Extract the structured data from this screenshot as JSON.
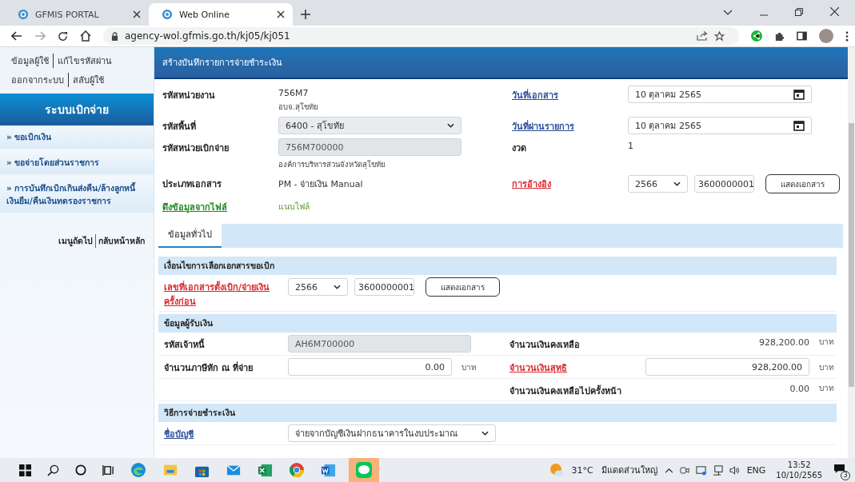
{
  "browser": {
    "tabs": [
      {
        "title": "GFMIS PORTAL",
        "selected": false
      },
      {
        "title": "Web Online",
        "selected": true
      }
    ],
    "url": "agency-wol.gfmis.go.th/kj05/kj051"
  },
  "sidebar": {
    "links": [
      [
        "ข้อมูลผู้ใช้",
        "แก้ไขรหัสผ่าน"
      ],
      [
        "ออกจากระบบ",
        "สลับผู้ใช้"
      ]
    ],
    "title": "ระบบเบิกจ่าย",
    "items": [
      "» ขอเบิกเงิน",
      "» ขอจ่ายโดยส่วนราชการ",
      "» การบันทึกเบิกเกินส่งคืน/ล้างลูกหนี้เงินยืม/คืนเงินทดรองราชการ"
    ],
    "footer_links": [
      "เมนูถัดไป",
      "กลับหน้าหลัก"
    ]
  },
  "page": {
    "subtitle": "สร้างบันทึกรายการจ่ายชำระเงิน"
  },
  "header_rows": [
    {
      "left": {
        "label": "รหัสหน่วยงาน",
        "link": false,
        "required": false,
        "kind": "text",
        "value": "756M7",
        "note": "อบจ.สุโขทัย"
      },
      "right": {
        "label": "วันที่เอกสาร",
        "link": true,
        "required": false,
        "kind": "date",
        "value": "10 ตุลาคม 2565"
      }
    },
    {
      "left": {
        "label": "รหัสพื้นที่",
        "link": false,
        "required": false,
        "kind": "select",
        "value": "6400 - สุโขทัย"
      },
      "right": {
        "label": "วันที่ผ่านรายการ",
        "link": true,
        "required": false,
        "kind": "date",
        "value": "10 ตุลาคม 2565"
      }
    },
    {
      "left": {
        "label": "รหัสหน่วยเบิกจ่าย",
        "link": false,
        "required": false,
        "kind": "disabled",
        "value": "756M700000",
        "note": "องค์การบริหารส่วนจังหวัดสุโขทัย"
      },
      "right": {
        "label": "งวด",
        "link": false,
        "required": false,
        "kind": "text",
        "value": "1"
      }
    },
    {
      "left": {
        "label": "ประเภทเอกสาร",
        "link": false,
        "required": false,
        "kind": "text",
        "value": "PM - จ่ายเงิน Manual"
      },
      "right": {
        "label": "การอ้างอิง",
        "link": true,
        "required": true,
        "kind": "reference",
        "year": "2566",
        "number": "3600000001",
        "button": "แสดงเอกสาร"
      }
    },
    {
      "left": {
        "label": "ดึงข้อมูลจากไฟล์",
        "link": true,
        "required": false,
        "kind": "file",
        "value": "แนบไฟล์"
      }
    }
  ],
  "tabs": [
    {
      "label": "ข้อมูลทั่วไป",
      "selected": true
    }
  ],
  "sections": [
    {
      "title": "เงื่อนไขการเลือกเอกสารขอเบิก",
      "rows": [
        {
          "left": {
            "label": "เลขที่เอกสารตั้งเบิก/จ่ายเงินครั้งก่อน",
            "link": true,
            "required": true,
            "kind": "reference",
            "year": "2566",
            "number": "3600000001",
            "button": "แสดงเอกสาร"
          }
        }
      ]
    },
    {
      "title": "ข้อมูลผู้รับเงิน",
      "rows": [
        {
          "left": {
            "label": "รหัสเจ้าหนี้",
            "link": false,
            "required": false,
            "kind": "disabled",
            "value": "AH6M700000"
          },
          "right": {
            "label": "จำนวนเงินคงเหลือ",
            "link": false,
            "required": false,
            "kind": "amount",
            "value": "928,200.00",
            "unit": "บาท"
          }
        },
        {
          "left": {
            "label": "จำนวนภาษีหัก ณ ที่จ่าย",
            "link": false,
            "required": false,
            "kind": "amount-input",
            "value": "0.00",
            "unit": "บาท"
          },
          "right": {
            "label": "จำนวนเงินสุทธิ",
            "link": true,
            "required": true,
            "kind": "amount-input",
            "value": "928,200.00",
            "unit": "บาท"
          }
        },
        {
          "right": {
            "label": "จำนวนเงินคงเหลือไปครั้งหน้า",
            "link": false,
            "required": false,
            "kind": "amount",
            "value": "0.00",
            "unit": "บาท"
          }
        }
      ]
    },
    {
      "title": "วิธีการจ่ายชำระเงิน",
      "rows": [
        {
          "left": {
            "label": "ชื่อบัญชี",
            "link": true,
            "required": false,
            "kind": "select",
            "value": "จ่ายจากบัญชีเงินฝากธนาคารในงบประมาณ"
          }
        }
      ]
    }
  ],
  "taskbar": {
    "weather": {
      "temp": "31°C",
      "text": "มีแดดส่วนใหญ่"
    },
    "language": "ENG",
    "time": "13:52",
    "date": "10/10/2565",
    "notifications": "3"
  }
}
